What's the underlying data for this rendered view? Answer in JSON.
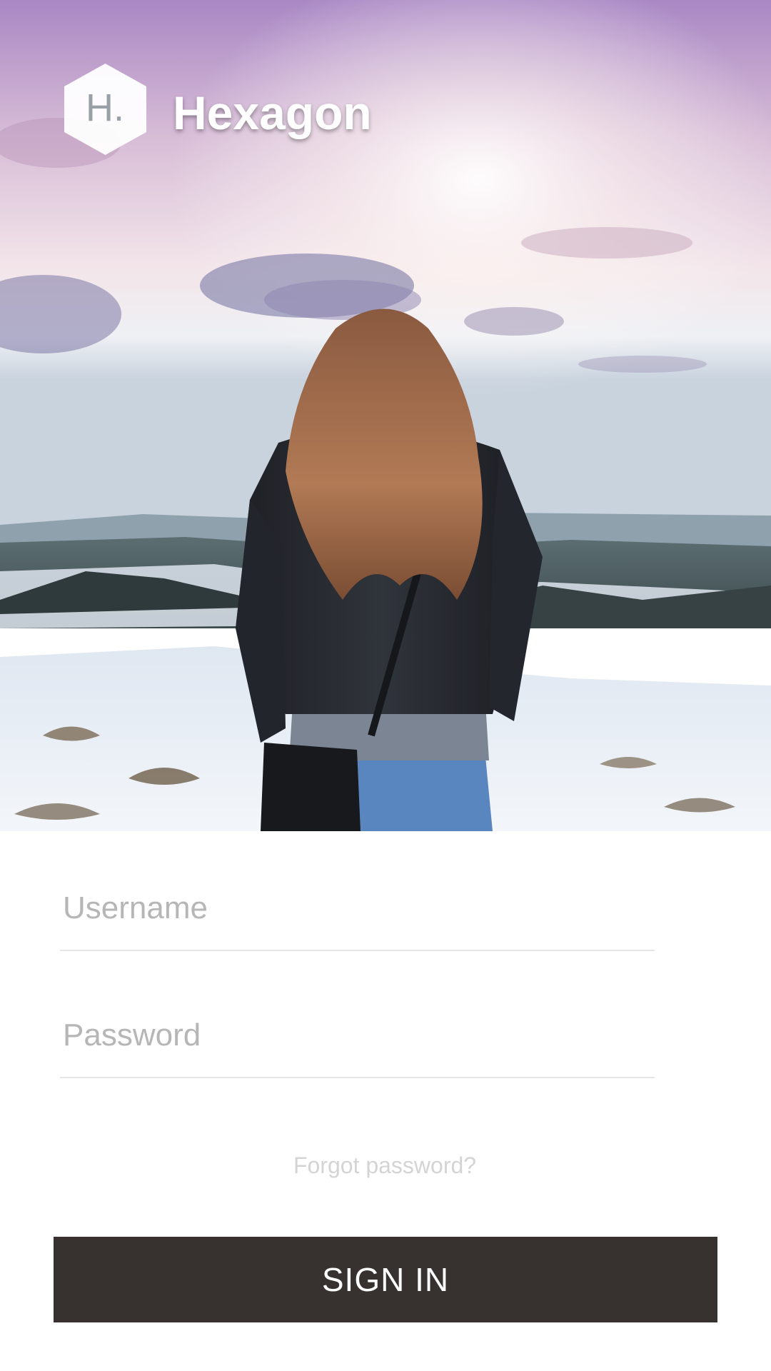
{
  "brand": {
    "logo_letter": "H.",
    "title": "Hexagon"
  },
  "hero": {
    "image_subject": "woman-on-snowy-hill-photo",
    "sky_colors": [
      "#b98fc9",
      "#e9d7e4",
      "#f6eef0"
    ],
    "snow_color": "#e6edf5"
  },
  "form": {
    "username": {
      "placeholder": "Username",
      "value": ""
    },
    "password": {
      "placeholder": "Password",
      "value": ""
    },
    "forgot_password_label": "Forgot password?",
    "sign_in_label": "SIGN IN"
  },
  "colors": {
    "button_bg": "#373130",
    "button_text": "#ffffff",
    "placeholder": "#b6b6b6",
    "link": "#d4d4d4"
  }
}
